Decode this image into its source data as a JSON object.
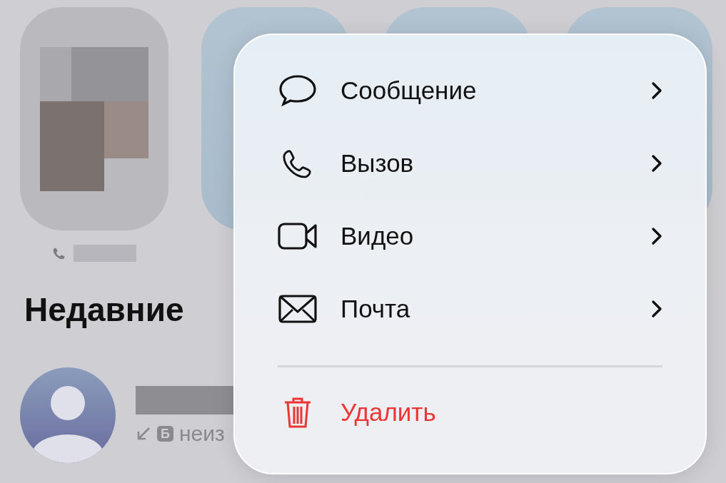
{
  "favorites": [
    {
      "kind": "picture",
      "call_icon": true
    },
    {
      "kind": "blank"
    },
    {
      "kind": "blank"
    },
    {
      "kind": "blank"
    }
  ],
  "recents": {
    "title": "Недавние",
    "items": [
      {
        "badge": "Б",
        "detail": "неиз"
      }
    ]
  },
  "context_menu": {
    "items": [
      {
        "label": "Сообщение",
        "kind": "submenu"
      },
      {
        "label": "Вызов",
        "kind": "submenu"
      },
      {
        "label": "Видео",
        "kind": "submenu"
      },
      {
        "label": "Почта",
        "kind": "submenu"
      },
      {
        "label": "Удалить",
        "kind": "destructive"
      }
    ]
  }
}
